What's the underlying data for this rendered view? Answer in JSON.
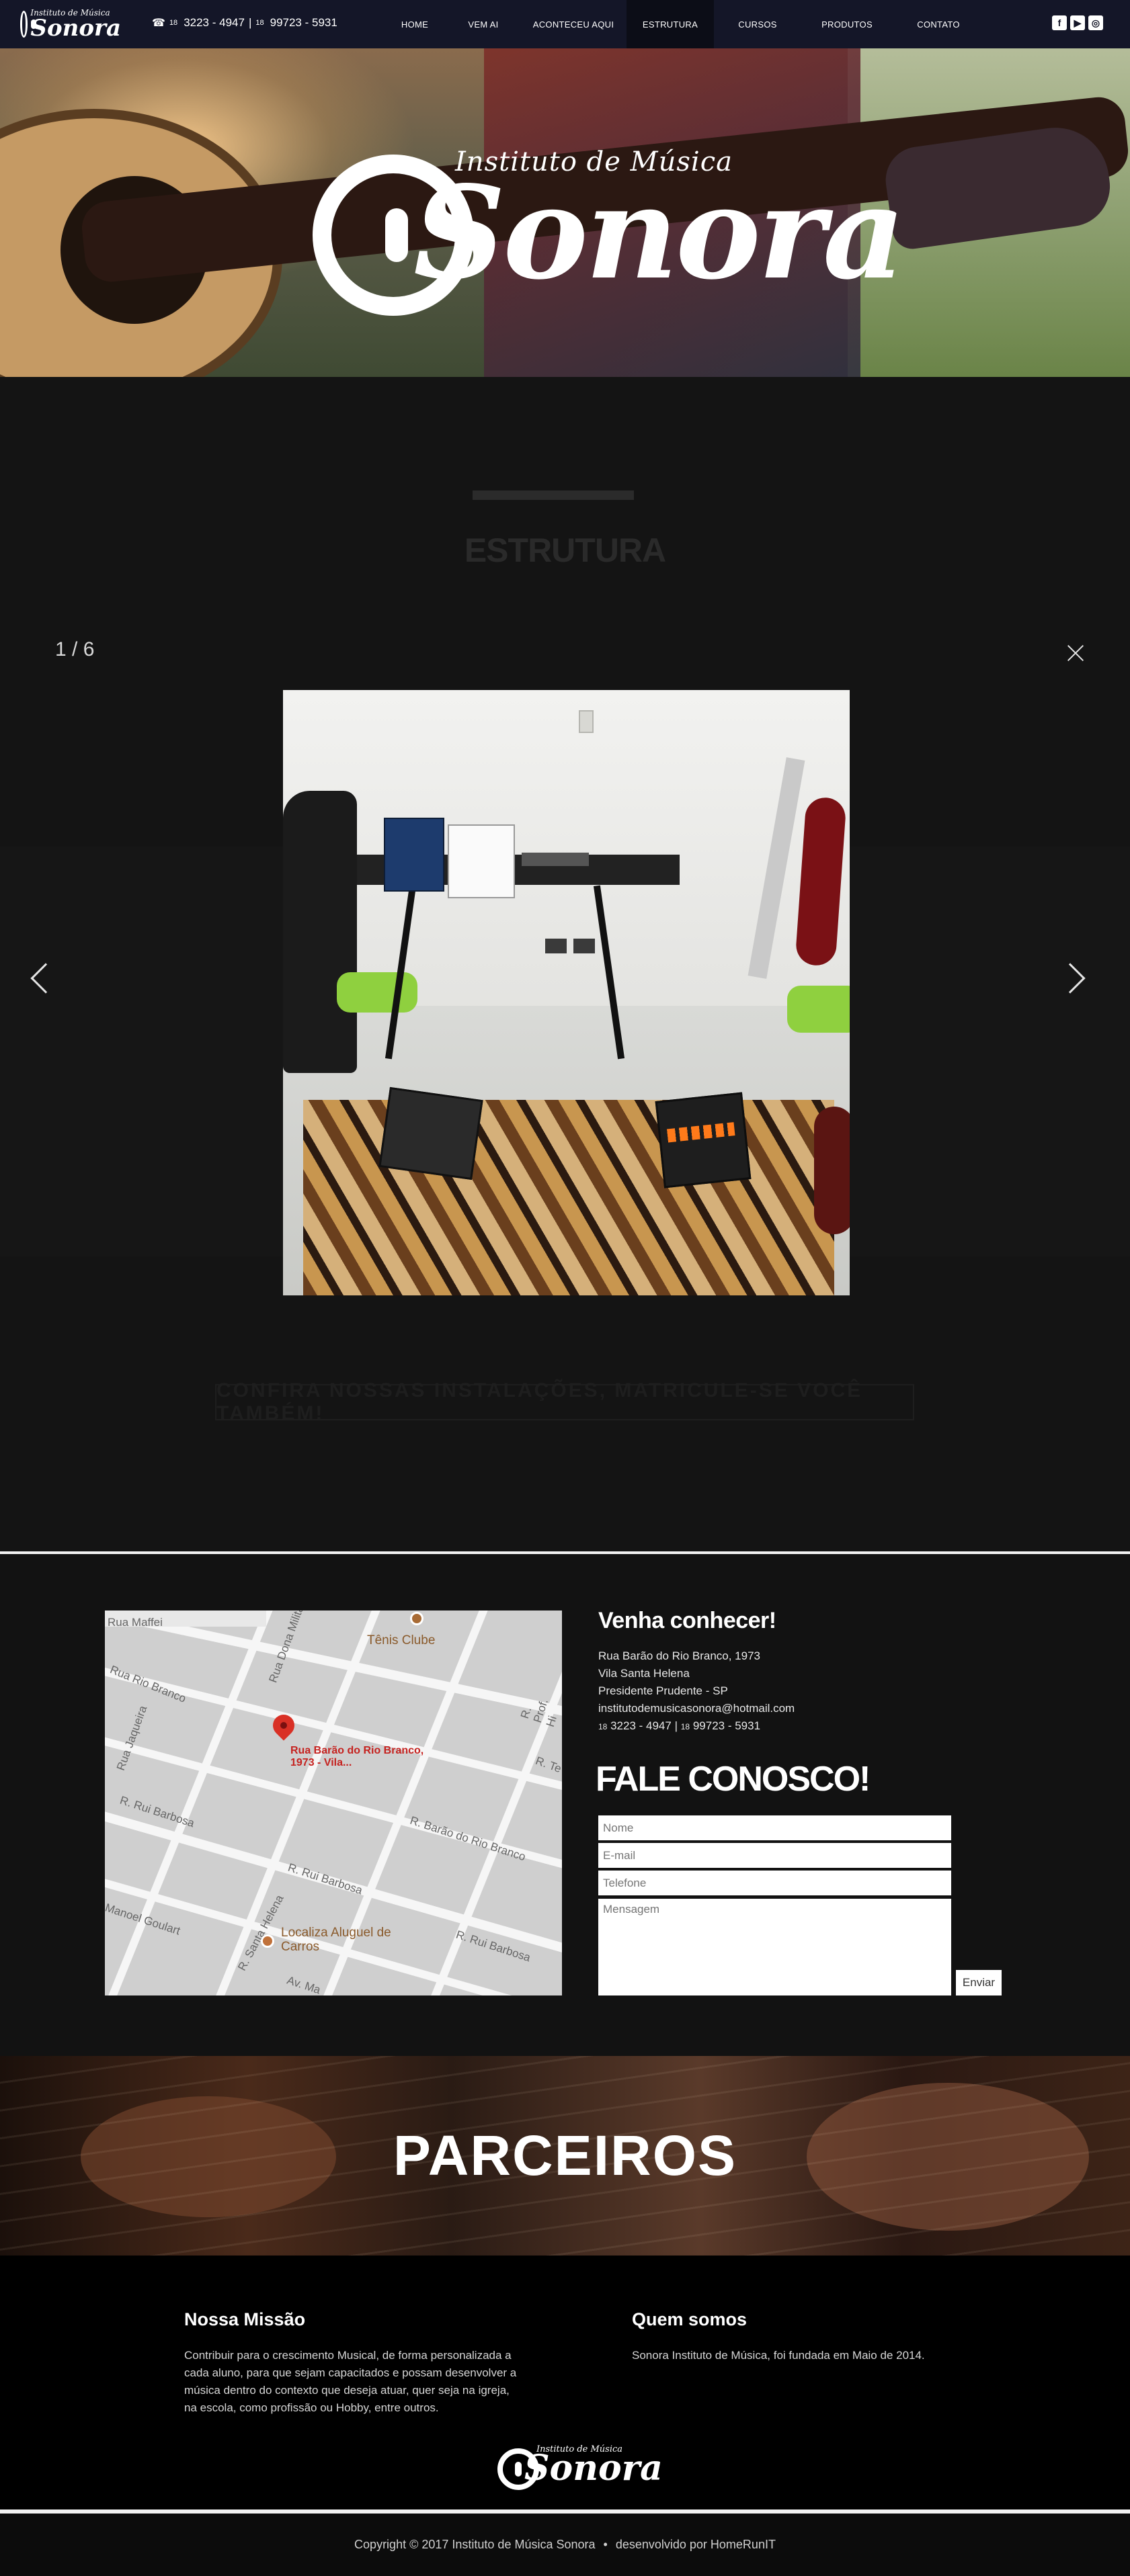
{
  "header": {
    "logo_tagline": "Instituto de Música",
    "logo_name": "Sonora",
    "phone_prefix1": "18",
    "phone1": "3223 - 4947",
    "separator": "|",
    "phone_prefix2": "18",
    "phone2": "99723 - 5931",
    "nav": [
      {
        "label": "HOME",
        "active": false
      },
      {
        "label": "VEM AI",
        "active": false
      },
      {
        "label": "ACONTECEU AQUI",
        "active": false
      },
      {
        "label": "ESTRUTURA",
        "active": true
      },
      {
        "label": "CURSOS",
        "active": false
      },
      {
        "label": "PRODUTOS",
        "active": false
      },
      {
        "label": "CONTATO",
        "active": false
      }
    ],
    "social": [
      {
        "icon": "facebook-icon",
        "glyph": "f"
      },
      {
        "icon": "youtube-icon",
        "glyph": "▶"
      },
      {
        "icon": "instagram-icon",
        "glyph": "◎"
      }
    ]
  },
  "hero": {
    "tagline": "Instituto de Música",
    "name": "Sonora"
  },
  "estrutura": {
    "title": "ESTRUTURA",
    "cta": "Confira nossas instalações, matricule-se você também!"
  },
  "lightbox": {
    "counter": "1 / 6",
    "close_icon": "close-icon",
    "prev_icon": "chevron-left-icon",
    "next_icon": "chevron-right-icon"
  },
  "contact": {
    "heading": "Venha conhecer!",
    "address_line1": "Rua Barão do Rio Branco, 1973",
    "address_line2": "Vila Santa Helena",
    "address_line3": "Presidente Prudente - SP",
    "email": "institutodemusicasonora@hotmail.com",
    "phone_prefix1": "18",
    "phone1": "3223 - 4947",
    "separator": "|",
    "phone_prefix2": "18",
    "phone2": "99723 - 5931",
    "form_title": "FALE CONOSCO!",
    "name_placeholder": "Nome",
    "email_placeholder": "E-mail",
    "phone_placeholder": "Telefone",
    "message_placeholder": "Mensagem",
    "send_label": "Enviar"
  },
  "map": {
    "labels": {
      "street1": "Rua Maffei",
      "club": "Tênis Clube",
      "street2": "Rua Rio Branco",
      "street3": "Rua Dona Militã",
      "street4": "Rua Jaqueira",
      "pin_label": "Rua Barão do Rio Branco, 1973 - Vila...",
      "street5": "R. Rui Barbosa",
      "street6": "R. Barão do Rio Branco",
      "street7": "R. Rui Barbosa",
      "street8": "Manoel Goulart",
      "street9": "R. Santa Helena",
      "street10": "R. Rui Barbosa",
      "poi": "Localiza Aluguel de Carros",
      "street11": "Av. Ma",
      "street12": "R. Prof. Hi",
      "street13": "R. Te"
    }
  },
  "parceiros": {
    "title": "PARCEIROS"
  },
  "footer": {
    "mission_title": "Nossa Missão",
    "mission_text": "Contribuir para o crescimento Musical, de forma personalizada a cada aluno, para que sejam capacitados e possam desenvolver a música dentro do contexto que deseja atuar, quer seja na igreja, na escola, como profissão ou Hobby, entre outros.",
    "about_title": "Quem somos",
    "about_text": "Sonora Instituto de Música, foi fundada em Maio de 2014.",
    "logo_tagline": "Instituto de Música",
    "logo_name": "Sonora",
    "copyright": "Copyright © 2017 Instituto de Música Sonora",
    "bullet": "•",
    "developer": "desenvolvido por HomeRunIT"
  }
}
